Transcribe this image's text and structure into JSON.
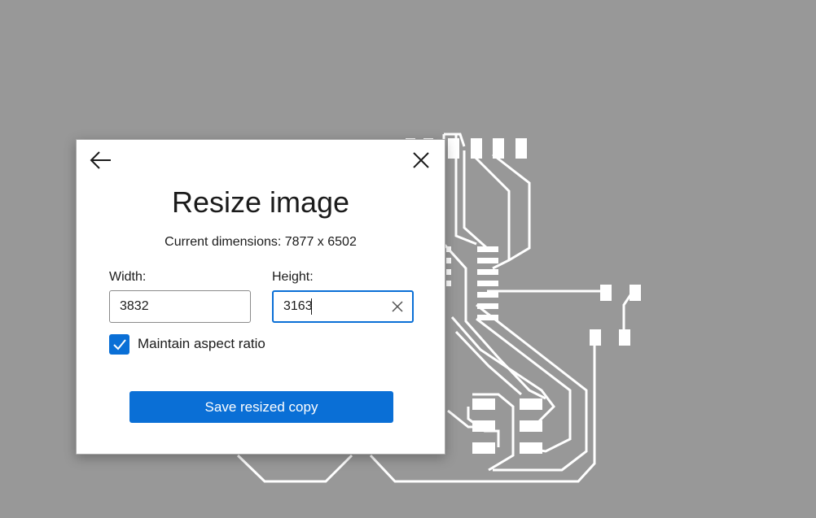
{
  "dialog": {
    "title": "Resize image",
    "current_dimensions": "Current dimensions: 7877 x 6502",
    "width_label": "Width:",
    "width_value": "3832",
    "height_label": "Height:",
    "height_value": "3163",
    "aspect_ratio_label": "Maintain aspect ratio",
    "aspect_ratio_checked": true,
    "save_label": "Save resized copy"
  },
  "icons": {
    "back": "arrow-left-icon",
    "close": "close-icon",
    "clear": "clear-icon",
    "check": "checkmark-icon"
  },
  "colors": {
    "accent": "#0a6fd6",
    "background": "#989898",
    "dialog": "#ffffff",
    "circuit_traces": "#ffffff"
  }
}
